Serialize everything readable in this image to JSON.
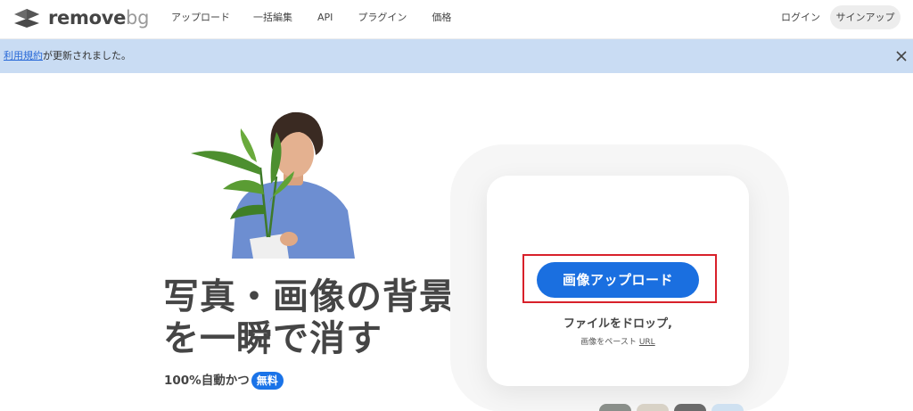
{
  "header": {
    "logo": {
      "word": "remove",
      "suffix": "bg",
      "icon": "stacked-layers-logo-icon"
    },
    "nav": [
      "アップロード",
      "一括編集",
      "API",
      "プラグイン",
      "価格"
    ],
    "login_label": "ログイン",
    "signup_label": "サインアップ"
  },
  "banner": {
    "link_text": "利用規約",
    "message": "が更新されました。",
    "close_icon": "close-icon"
  },
  "hero": {
    "headline_line1": "写真・画像の背景",
    "headline_line2": "を一瞬で消す",
    "free_prefix": "100%自動かつ",
    "free_badge": "無料",
    "image_icon": "man-holding-plant-photo"
  },
  "upload": {
    "button_label": "画像アップロード",
    "drop_text": "ファイルをドロップ,",
    "paste_text": "画像をペースト",
    "url_label": "URL"
  },
  "colors": {
    "accent": "#1a6fe0",
    "banner_bg": "#c9dcf3",
    "highlight": "#d8202a",
    "text": "#454545"
  }
}
